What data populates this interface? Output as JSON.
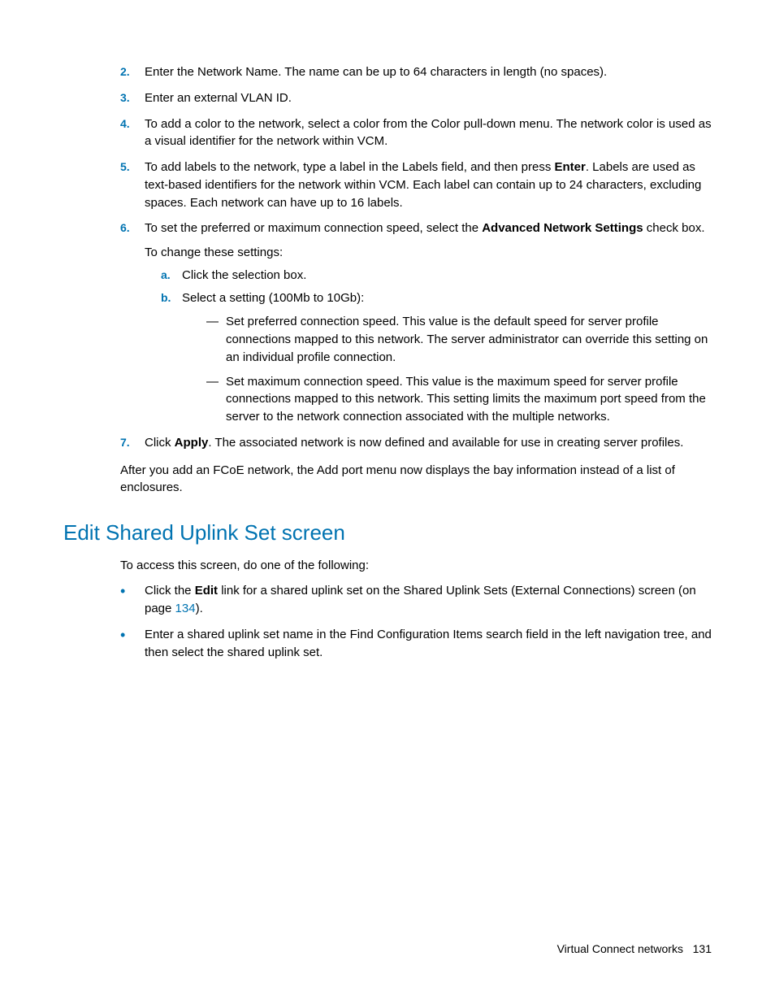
{
  "steps": {
    "s2": {
      "num": "2.",
      "text": "Enter the Network Name. The name can be up to 64 characters in length (no spaces)."
    },
    "s3": {
      "num": "3.",
      "text": "Enter an external VLAN ID."
    },
    "s4": {
      "num": "4.",
      "text": "To add a color to the network, select a color from the Color pull-down menu. The network color is used as a visual identifier for the network within VCM."
    },
    "s5": {
      "num": "5.",
      "pre": "To add labels to the network, type a label in the Labels field, and then press ",
      "bold": "Enter",
      "post": ". Labels are used as text-based identifiers for the network within VCM. Each label can contain up to 24 characters, excluding spaces. Each network can have up to 16 labels."
    },
    "s6": {
      "num": "6.",
      "pre": "To set the preferred or maximum connection speed, select the ",
      "bold": "Advanced Network Settings",
      "post": " check box.",
      "changeline": "To change these settings:",
      "a": {
        "marker": "a.",
        "text": "Click the selection box."
      },
      "b": {
        "marker": "b.",
        "text": "Select a setting (100Mb to 10Gb):",
        "d1": "Set preferred connection speed. This value is the default speed for server profile connections mapped to this network. The server administrator can override this setting on an individual profile connection.",
        "d2": "Set maximum connection speed. This value is the maximum speed for server profile connections mapped to this network. This setting limits the maximum port speed from the server to the network connection associated with the multiple networks."
      }
    },
    "s7": {
      "num": "7.",
      "pre": "Click ",
      "bold": "Apply",
      "post": ". The associated network is now defined and available for use in creating server profiles."
    }
  },
  "afterPara": "After you add an FCoE network, the Add port menu now displays the bay information instead of a list of enclosures.",
  "heading": "Edit Shared Uplink Set screen",
  "intro": "To access this screen, do one of the following:",
  "bullets": {
    "b1": {
      "pre": "Click the ",
      "bold": "Edit",
      "mid": " link for a shared uplink set on the Shared Uplink Sets (External Connections) screen (on page ",
      "link": "134",
      "post": ")."
    },
    "b2": "Enter a shared uplink set name in the Find Configuration Items search field in the left navigation tree, and then select the shared uplink set."
  },
  "dash": "—",
  "bulletGlyph": "•",
  "footer": {
    "section": "Virtual Connect networks",
    "page": "131"
  }
}
